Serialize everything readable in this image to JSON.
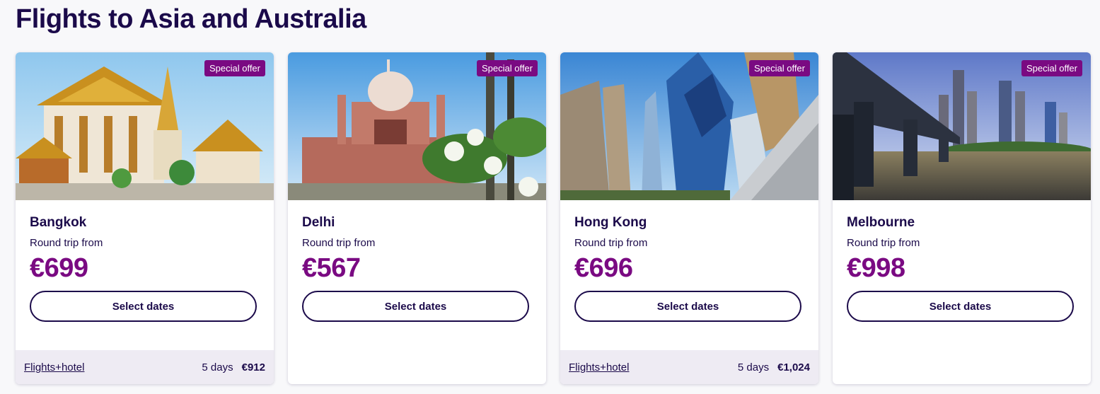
{
  "page": {
    "title": "Flights to Asia and Australia"
  },
  "cards": [
    {
      "city": "Bangkok",
      "badge": "Special offer",
      "subtitle": "Round trip from",
      "price": "€699",
      "button": "Select dates",
      "footer": {
        "link": "Flights+hotel",
        "duration": "5 days",
        "price": "€912"
      }
    },
    {
      "city": "Delhi",
      "badge": "Special offer",
      "subtitle": "Round trip from",
      "price": "€567",
      "button": "Select dates"
    },
    {
      "city": "Hong Kong",
      "badge": "Special offer",
      "subtitle": "Round trip from",
      "price": "€696",
      "button": "Select dates",
      "footer": {
        "link": "Flights+hotel",
        "duration": "5 days",
        "price": "€1,024"
      }
    },
    {
      "city": "Melbourne",
      "badge": "Special offer",
      "subtitle": "Round trip from",
      "price": "€998",
      "button": "Select dates"
    }
  ],
  "colors": {
    "brand": "#1b0a4a",
    "accent": "#7a0a82",
    "footer_bg": "#eeebf3"
  }
}
